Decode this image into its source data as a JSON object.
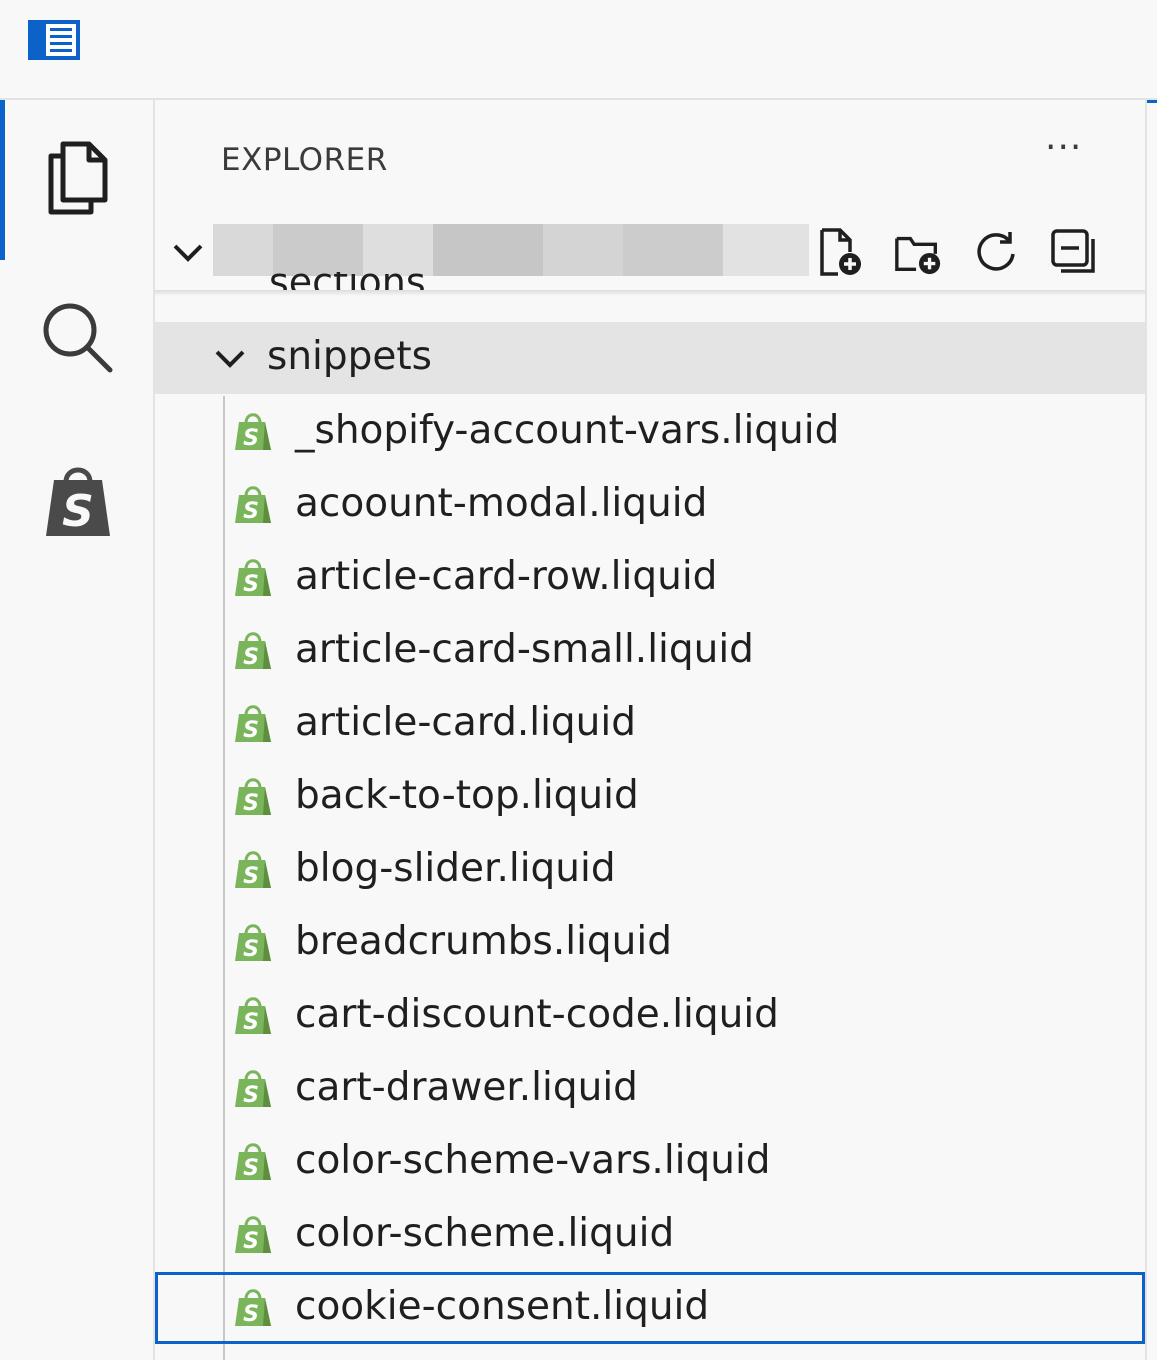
{
  "title_bar": {
    "layout_icon": "panel-layout-icon"
  },
  "activity_bar": {
    "items": [
      {
        "icon": "files-icon",
        "active": true
      },
      {
        "icon": "search-icon",
        "active": false
      },
      {
        "icon": "shopify-icon",
        "active": false
      }
    ]
  },
  "explorer": {
    "title": "EXPLORER",
    "more_label": "···",
    "folder": {
      "name_redacted": true,
      "actions": [
        "new-file-icon",
        "new-folder-icon",
        "refresh-icon",
        "collapse-all-icon"
      ]
    },
    "tree": {
      "sections_label": "sections",
      "snippets_label": "snippets",
      "files": [
        "_shopify-account-vars.liquid",
        "acoount-modal.liquid",
        "article-card-row.liquid",
        "article-card-small.liquid",
        "article-card.liquid",
        "back-to-top.liquid",
        "blog-slider.liquid",
        "breadcrumbs.liquid",
        "cart-discount-code.liquid",
        "cart-drawer.liquid",
        "color-scheme-vars.liquid",
        "color-scheme.liquid",
        "cookie-consent.liquid"
      ],
      "selected_index": 12
    }
  },
  "colors": {
    "accent": "#0c62c9",
    "shopify_green": "#7ab55c",
    "selected_row": "#e4e4e4"
  }
}
